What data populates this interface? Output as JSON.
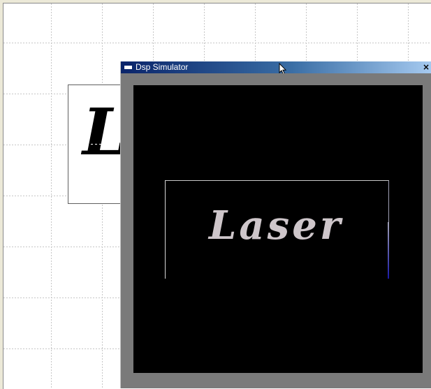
{
  "editor": {
    "canvas_text": "L"
  },
  "simulator_window": {
    "title": "Dsp Simulator",
    "close_label": "×",
    "display_text": "Laser"
  },
  "colors": {
    "title_bar_start": "#0a246a",
    "title_bar_end": "#a6caf0",
    "screen_background": "#000000",
    "laser_text": "#cec6ca"
  },
  "icons": {
    "window_icon": "window-icon",
    "close": "close-icon",
    "cursor": "mouse-pointer-icon"
  }
}
